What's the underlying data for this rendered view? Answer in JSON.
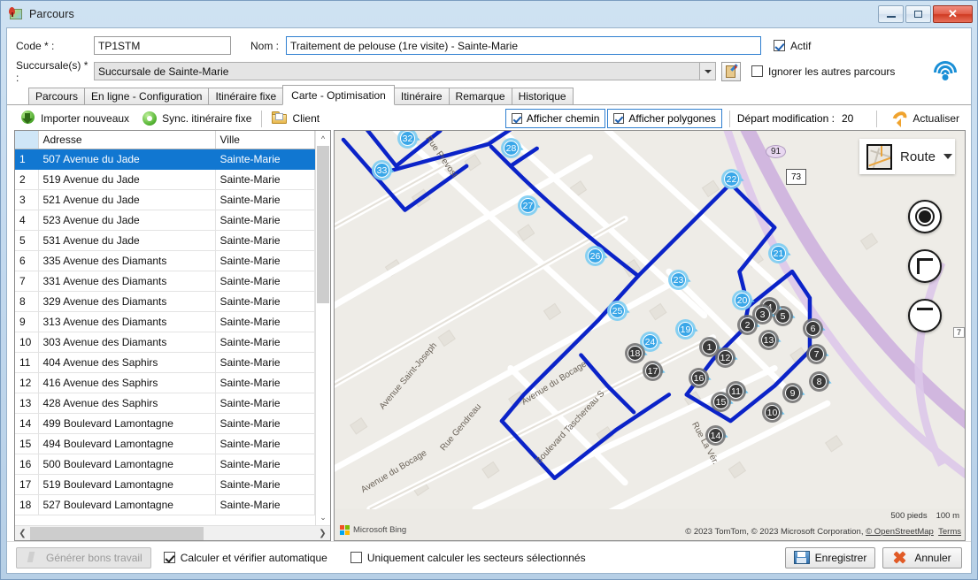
{
  "window": {
    "title": "Parcours",
    "icon": "map-pin-icon",
    "buttons": {
      "minimize": "minimize-icon",
      "maximize": "maximize-icon",
      "close": "✕"
    }
  },
  "form": {
    "code_label": "Code * :",
    "code_value": "TP1STM",
    "nom_label": "Nom :",
    "nom_value": "Traitement de pelouse (1re visite) - Sainte-Marie",
    "succursale_label": "Succursale(s) * :",
    "succursale_value": "Succursale de Sainte-Marie",
    "actif_label": "Actif",
    "actif_checked": true,
    "ignorer_label": "Ignorer les autres parcours",
    "ignorer_checked": false
  },
  "tabs": [
    {
      "label": "Parcours",
      "active": false
    },
    {
      "label": "En ligne - Configuration",
      "active": false
    },
    {
      "label": "Itinéraire fixe",
      "active": false
    },
    {
      "label": "Carte - Optimisation",
      "active": true
    },
    {
      "label": "Itinéraire",
      "active": false
    },
    {
      "label": "Remarque",
      "active": false
    },
    {
      "label": "Historique",
      "active": false
    }
  ],
  "toolbar": {
    "importer_label": "Importer nouveaux",
    "sync_label": "Sync. itinéraire fixe",
    "client_label": "Client",
    "afficher_chemin_label": "Afficher chemin",
    "afficher_chemin_checked": true,
    "afficher_polygones_label": "Afficher polygones",
    "afficher_polygones_checked": true,
    "depart_label": "Départ modification :",
    "depart_value": "20",
    "actualiser_label": "Actualiser"
  },
  "grid": {
    "columns": [
      "",
      "Adresse",
      "Ville"
    ],
    "selected_row": 1,
    "rows": [
      {
        "n": "1",
        "adresse": "507 Avenue du Jade",
        "ville": "Sainte-Marie"
      },
      {
        "n": "2",
        "adresse": "519 Avenue du Jade",
        "ville": "Sainte-Marie"
      },
      {
        "n": "3",
        "adresse": "521 Avenue du Jade",
        "ville": "Sainte-Marie"
      },
      {
        "n": "4",
        "adresse": "523 Avenue du Jade",
        "ville": "Sainte-Marie"
      },
      {
        "n": "5",
        "adresse": "531 Avenue du Jade",
        "ville": "Sainte-Marie"
      },
      {
        "n": "6",
        "adresse": "335 Avenue des Diamants",
        "ville": "Sainte-Marie"
      },
      {
        "n": "7",
        "adresse": "331 Avenue des Diamants",
        "ville": "Sainte-Marie"
      },
      {
        "n": "8",
        "adresse": "329 Avenue des Diamants",
        "ville": "Sainte-Marie"
      },
      {
        "n": "9",
        "adresse": "313 Avenue des Diamants",
        "ville": "Sainte-Marie"
      },
      {
        "n": "10",
        "adresse": "303 Avenue des Diamants",
        "ville": "Sainte-Marie"
      },
      {
        "n": "11",
        "adresse": "404 Avenue des Saphirs",
        "ville": "Sainte-Marie"
      },
      {
        "n": "12",
        "adresse": "416 Avenue des Saphirs",
        "ville": "Sainte-Marie"
      },
      {
        "n": "13",
        "adresse": "428 Avenue des Saphirs",
        "ville": "Sainte-Marie"
      },
      {
        "n": "14",
        "adresse": "499 Boulevard Lamontagne",
        "ville": "Sainte-Marie"
      },
      {
        "n": "15",
        "adresse": "494 Boulevard Lamontagne",
        "ville": "Sainte-Marie"
      },
      {
        "n": "16",
        "adresse": "500 Boulevard Lamontagne",
        "ville": "Sainte-Marie"
      },
      {
        "n": "17",
        "adresse": "519 Boulevard Lamontagne",
        "ville": "Sainte-Marie"
      },
      {
        "n": "18",
        "adresse": "527 Boulevard Lamontagne",
        "ville": "Sainte-Marie"
      }
    ]
  },
  "map": {
    "layer_label": "Route",
    "controls": {
      "locate": "locate-icon",
      "zoom_in": "+",
      "zoom_out": "−"
    },
    "streets": [
      "Rue Prevost",
      "Avenue Saint-Joseph",
      "Rue Gendreau",
      "Avenue du Bocage",
      "Boulevard Taschereau S",
      "Rue La Vér."
    ],
    "highway_shields": [
      {
        "kind": "oval",
        "label": "91"
      },
      {
        "kind": "shield",
        "label": "73"
      }
    ],
    "edge_label": "7",
    "scale": [
      {
        "label": "500 pieds"
      },
      {
        "label": "100 m"
      }
    ],
    "brand": "Microsoft Bing",
    "attribution": "© 2023 TomTom, © 2023 Microsoft Corporation, ",
    "attribution_osm": "© OpenStreetMap",
    "attribution_terms": "Terms",
    "markers_dark": [
      "1",
      "2",
      "3",
      "4",
      "5",
      "6",
      "7",
      "8",
      "9",
      "10",
      "11",
      "12",
      "13",
      "14",
      "15",
      "16",
      "17",
      "18"
    ],
    "markers_light": [
      "19",
      "20",
      "21",
      "22",
      "23",
      "24",
      "25",
      "26",
      "27",
      "28",
      "32",
      "33"
    ]
  },
  "bottom": {
    "generer_label": "Générer bons travail",
    "generer_disabled": true,
    "calculer_label": "Calculer et vérifier automatique",
    "calculer_checked": true,
    "uniquement_label": "Uniquement calculer les secteurs sélectionnés",
    "uniquement_checked": false,
    "enregistrer_label": "Enregistrer",
    "annuler_label": "Annuler"
  }
}
